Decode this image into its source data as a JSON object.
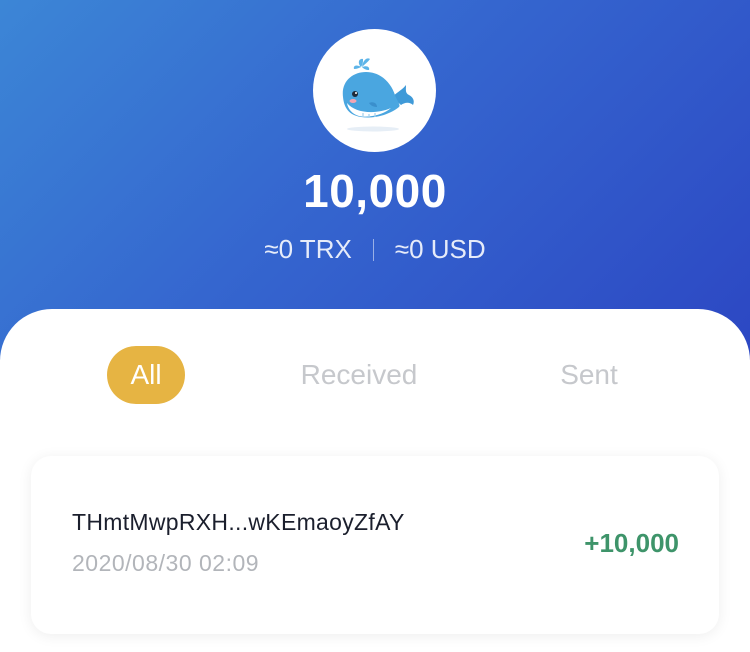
{
  "token": {
    "logo_icon": "whale-icon",
    "balance": "10,000",
    "trx_value": "≈0 TRX",
    "usd_value": "≈0 USD"
  },
  "tabs": [
    {
      "label": "All",
      "active": true
    },
    {
      "label": "Received",
      "active": false
    },
    {
      "label": "Sent",
      "active": false
    }
  ],
  "transactions": [
    {
      "address": "THmtMwpRXH...wKEmaoyZfAY",
      "time": "2020/08/30 02:09",
      "amount": "+10,000"
    }
  ],
  "colors": {
    "header_gradient_start": "#3c86d6",
    "header_gradient_end": "#2c47c3",
    "active_tab": "#e6b443",
    "positive_amount": "#3e946a"
  }
}
